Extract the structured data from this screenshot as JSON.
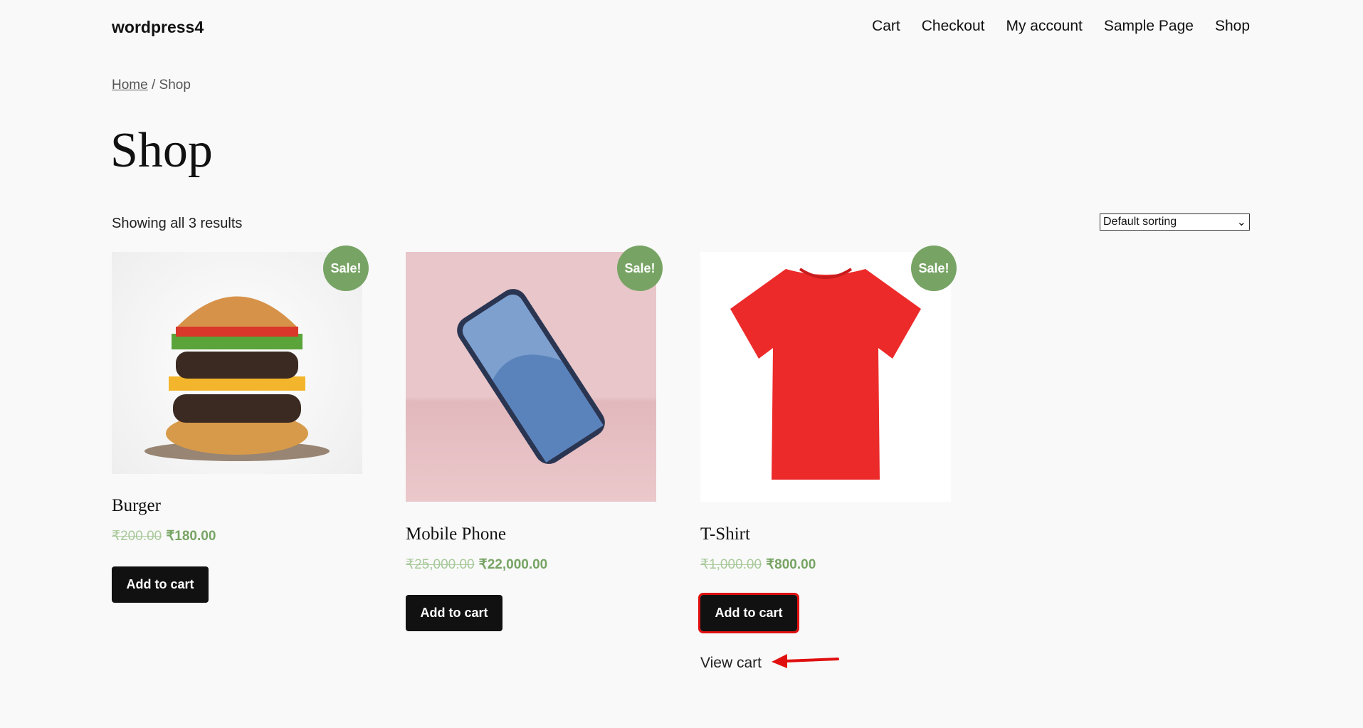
{
  "site_title": "wordpress4",
  "nav": [
    "Cart",
    "Checkout",
    "My account",
    "Sample Page",
    "Shop"
  ],
  "breadcrumb": {
    "home": "Home",
    "separator": " / ",
    "current": "Shop"
  },
  "page_title": "Shop",
  "result_count": "Showing all 3 results",
  "sorting": {
    "selected": "Default sorting"
  },
  "products": [
    {
      "name": "Burger",
      "regular_price": "₹200.00",
      "sale_price": "₹180.00",
      "badge": "Sale!",
      "button": "Add to cart"
    },
    {
      "name": "Mobile Phone",
      "regular_price": "₹25,000.00",
      "sale_price": "₹22,000.00",
      "badge": "Sale!",
      "button": "Add to cart"
    },
    {
      "name": "T-Shirt",
      "regular_price": "₹1,000.00",
      "sale_price": "₹800.00",
      "badge": "Sale!",
      "button": "Add to cart"
    }
  ],
  "view_cart": "View cart",
  "colors": {
    "sale_badge": "#77a464",
    "button": "#111111",
    "highlight": "#e01010"
  }
}
